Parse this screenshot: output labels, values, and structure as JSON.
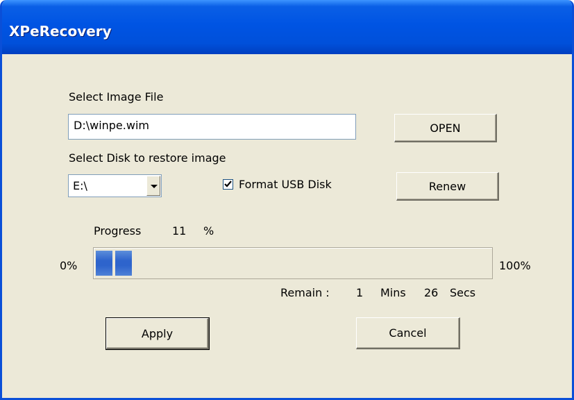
{
  "window": {
    "title": "XPeRecovery"
  },
  "image_file": {
    "label": "Select Image File",
    "path": "D:\\winpe.wim",
    "open_button": "OPEN"
  },
  "disk": {
    "label": "Select Disk to restore image",
    "selected": "E:\\",
    "format_checkbox_label": "Format USB Disk",
    "format_checked": true,
    "renew_button": "Renew"
  },
  "progress": {
    "label": "Progress",
    "value": "11",
    "unit": "%",
    "fraction": 0.11,
    "min_label": "0%",
    "max_label": "100%",
    "remain_label": "Remain :",
    "remain_mins": "1",
    "mins_label": "Mins",
    "remain_secs": "26",
    "secs_label": "Secs"
  },
  "actions": {
    "apply": "Apply",
    "cancel": "Cancel"
  },
  "colors": {
    "title_bar": "#0054E3",
    "dialog_bg": "#ECE9D8",
    "progress_fill": "#2E64CC"
  }
}
